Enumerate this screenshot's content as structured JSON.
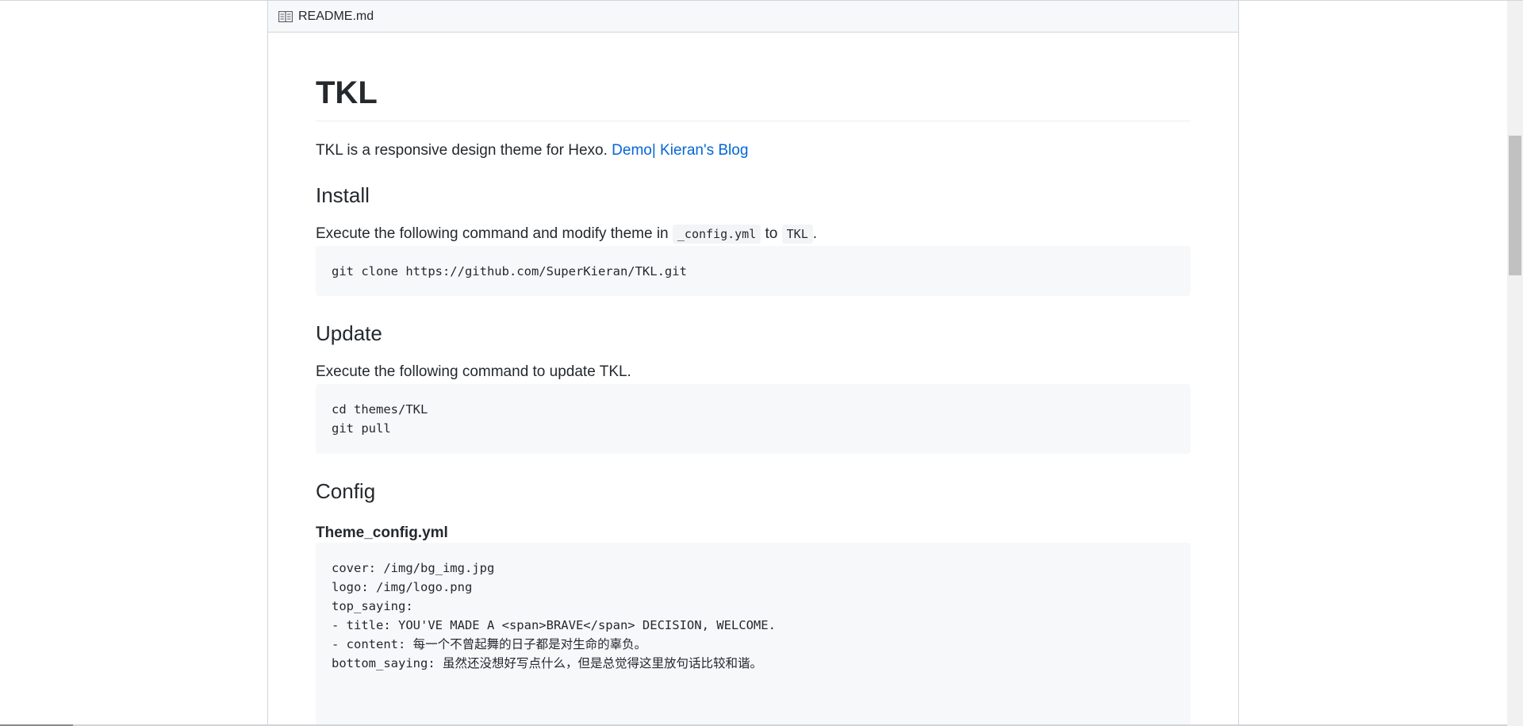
{
  "readme": {
    "filename": "README.md",
    "header_icon": "book-icon",
    "title": "TKL",
    "intro_text": "TKL is a responsive design theme for Hexo. ",
    "intro_link": "Demo| Kieran's Blog",
    "install": {
      "heading": "Install",
      "text_before": "Execute the following command and modify theme in ",
      "code1": "_config.yml",
      "text_mid": " to ",
      "code2": "TKL",
      "text_after": ".",
      "command": "git clone https://github.com/SuperKieran/TKL.git"
    },
    "update": {
      "heading": "Update",
      "text": "Execute the following command to update TKL.",
      "command": "cd themes/TKL\ngit pull"
    },
    "config": {
      "heading": "Config",
      "subheading": "Theme_config.yml",
      "code": "cover: /img/bg_img.jpg\nlogo: /img/logo.png\ntop_saying:\n- title: YOU'VE MADE A <span>BRAVE</span> DECISION, WELCOME.\n- content: 每一个不曾起舞的日子都是对生命的辜负。\nbottom_saying: 虽然还没想好写点什么，但是总觉得这里放句话比较和谐。"
    }
  },
  "colors": {
    "link": "#0366d6",
    "header_bg": "#f6f8fa",
    "code_bg": "#f6f8fa",
    "border": "#d1d5da"
  }
}
